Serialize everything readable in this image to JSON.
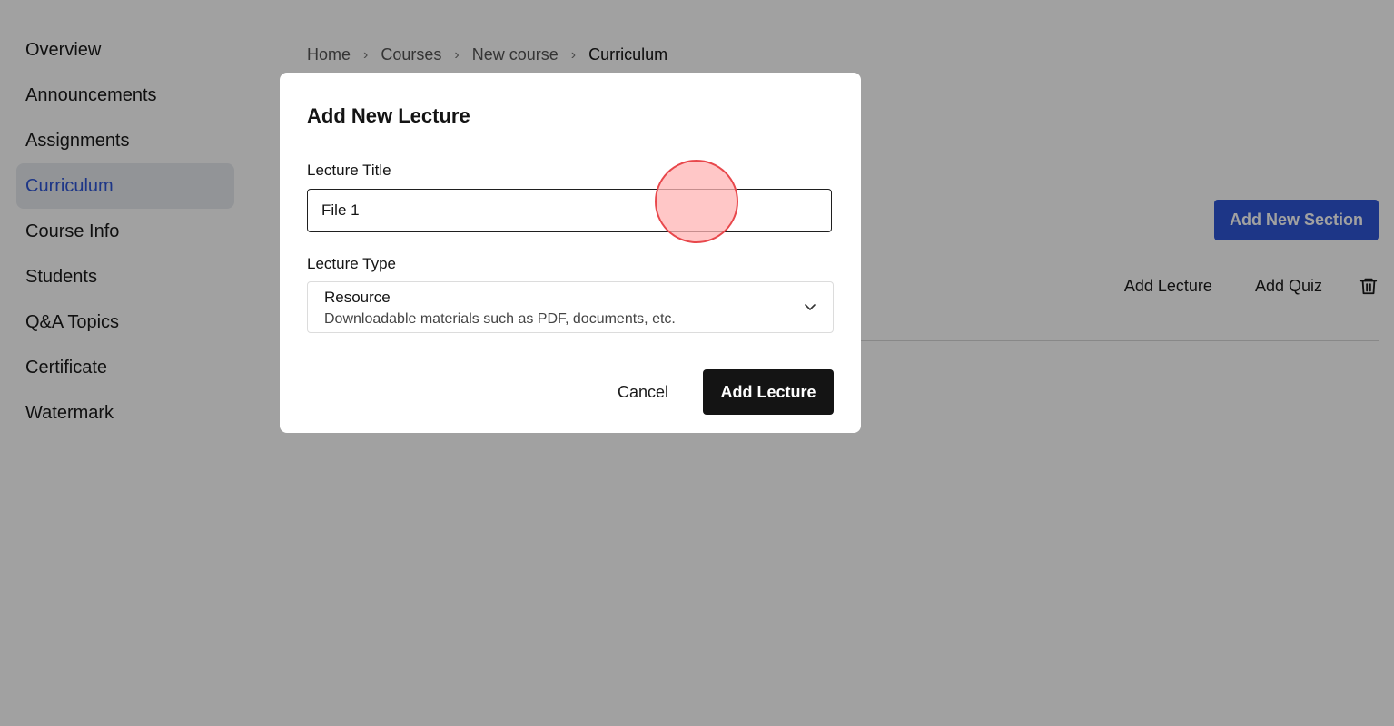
{
  "sidebar": {
    "items": [
      {
        "label": "Overview"
      },
      {
        "label": "Announcements"
      },
      {
        "label": "Assignments"
      },
      {
        "label": "Curriculum"
      },
      {
        "label": "Course Info"
      },
      {
        "label": "Students"
      },
      {
        "label": "Q&A Topics"
      },
      {
        "label": "Certificate"
      },
      {
        "label": "Watermark"
      }
    ],
    "active_index": 3
  },
  "breadcrumb": [
    "Home",
    "Courses",
    "New course",
    "Curriculum"
  ],
  "main": {
    "add_section_label": "Add New Section",
    "section_actions": {
      "add_lecture": "Add Lecture",
      "add_quiz": "Add Quiz",
      "delete_icon": "trash-icon"
    }
  },
  "modal": {
    "title": "Add New Lecture",
    "lecture_title_label": "Lecture Title",
    "lecture_title_value": "File 1",
    "lecture_type_label": "Lecture Type",
    "lecture_type_selected": "Resource",
    "lecture_type_description": "Downloadable materials such as PDF, documents, etc.",
    "cancel_label": "Cancel",
    "submit_label": "Add Lecture"
  },
  "colors": {
    "accent": "#2e56d6",
    "primary_button": "#141414",
    "overlay": "rgba(0,0,0,0.37)",
    "click_indicator": "#e8484c"
  }
}
